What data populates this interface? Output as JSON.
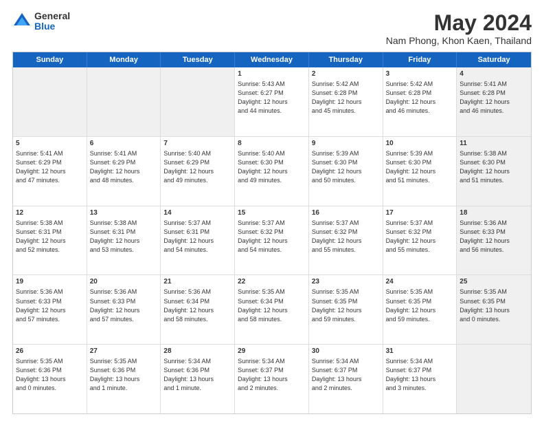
{
  "logo": {
    "general": "General",
    "blue": "Blue"
  },
  "title": "May 2024",
  "subtitle": "Nam Phong, Khon Kaen, Thailand",
  "header_days": [
    "Sunday",
    "Monday",
    "Tuesday",
    "Wednesday",
    "Thursday",
    "Friday",
    "Saturday"
  ],
  "weeks": [
    [
      {
        "day": "",
        "info": "",
        "shaded": true
      },
      {
        "day": "",
        "info": "",
        "shaded": true
      },
      {
        "day": "",
        "info": "",
        "shaded": true
      },
      {
        "day": "1",
        "info": "Sunrise: 5:43 AM\nSunset: 6:27 PM\nDaylight: 12 hours\nand 44 minutes.",
        "shaded": false
      },
      {
        "day": "2",
        "info": "Sunrise: 5:42 AM\nSunset: 6:28 PM\nDaylight: 12 hours\nand 45 minutes.",
        "shaded": false
      },
      {
        "day": "3",
        "info": "Sunrise: 5:42 AM\nSunset: 6:28 PM\nDaylight: 12 hours\nand 46 minutes.",
        "shaded": false
      },
      {
        "day": "4",
        "info": "Sunrise: 5:41 AM\nSunset: 6:28 PM\nDaylight: 12 hours\nand 46 minutes.",
        "shaded": true
      }
    ],
    [
      {
        "day": "5",
        "info": "Sunrise: 5:41 AM\nSunset: 6:29 PM\nDaylight: 12 hours\nand 47 minutes.",
        "shaded": false
      },
      {
        "day": "6",
        "info": "Sunrise: 5:41 AM\nSunset: 6:29 PM\nDaylight: 12 hours\nand 48 minutes.",
        "shaded": false
      },
      {
        "day": "7",
        "info": "Sunrise: 5:40 AM\nSunset: 6:29 PM\nDaylight: 12 hours\nand 49 minutes.",
        "shaded": false
      },
      {
        "day": "8",
        "info": "Sunrise: 5:40 AM\nSunset: 6:30 PM\nDaylight: 12 hours\nand 49 minutes.",
        "shaded": false
      },
      {
        "day": "9",
        "info": "Sunrise: 5:39 AM\nSunset: 6:30 PM\nDaylight: 12 hours\nand 50 minutes.",
        "shaded": false
      },
      {
        "day": "10",
        "info": "Sunrise: 5:39 AM\nSunset: 6:30 PM\nDaylight: 12 hours\nand 51 minutes.",
        "shaded": false
      },
      {
        "day": "11",
        "info": "Sunrise: 5:38 AM\nSunset: 6:30 PM\nDaylight: 12 hours\nand 51 minutes.",
        "shaded": true
      }
    ],
    [
      {
        "day": "12",
        "info": "Sunrise: 5:38 AM\nSunset: 6:31 PM\nDaylight: 12 hours\nand 52 minutes.",
        "shaded": false
      },
      {
        "day": "13",
        "info": "Sunrise: 5:38 AM\nSunset: 6:31 PM\nDaylight: 12 hours\nand 53 minutes.",
        "shaded": false
      },
      {
        "day": "14",
        "info": "Sunrise: 5:37 AM\nSunset: 6:31 PM\nDaylight: 12 hours\nand 54 minutes.",
        "shaded": false
      },
      {
        "day": "15",
        "info": "Sunrise: 5:37 AM\nSunset: 6:32 PM\nDaylight: 12 hours\nand 54 minutes.",
        "shaded": false
      },
      {
        "day": "16",
        "info": "Sunrise: 5:37 AM\nSunset: 6:32 PM\nDaylight: 12 hours\nand 55 minutes.",
        "shaded": false
      },
      {
        "day": "17",
        "info": "Sunrise: 5:37 AM\nSunset: 6:32 PM\nDaylight: 12 hours\nand 55 minutes.",
        "shaded": false
      },
      {
        "day": "18",
        "info": "Sunrise: 5:36 AM\nSunset: 6:33 PM\nDaylight: 12 hours\nand 56 minutes.",
        "shaded": true
      }
    ],
    [
      {
        "day": "19",
        "info": "Sunrise: 5:36 AM\nSunset: 6:33 PM\nDaylight: 12 hours\nand 57 minutes.",
        "shaded": false
      },
      {
        "day": "20",
        "info": "Sunrise: 5:36 AM\nSunset: 6:33 PM\nDaylight: 12 hours\nand 57 minutes.",
        "shaded": false
      },
      {
        "day": "21",
        "info": "Sunrise: 5:36 AM\nSunset: 6:34 PM\nDaylight: 12 hours\nand 58 minutes.",
        "shaded": false
      },
      {
        "day": "22",
        "info": "Sunrise: 5:35 AM\nSunset: 6:34 PM\nDaylight: 12 hours\nand 58 minutes.",
        "shaded": false
      },
      {
        "day": "23",
        "info": "Sunrise: 5:35 AM\nSunset: 6:35 PM\nDaylight: 12 hours\nand 59 minutes.",
        "shaded": false
      },
      {
        "day": "24",
        "info": "Sunrise: 5:35 AM\nSunset: 6:35 PM\nDaylight: 12 hours\nand 59 minutes.",
        "shaded": false
      },
      {
        "day": "25",
        "info": "Sunrise: 5:35 AM\nSunset: 6:35 PM\nDaylight: 13 hours\nand 0 minutes.",
        "shaded": true
      }
    ],
    [
      {
        "day": "26",
        "info": "Sunrise: 5:35 AM\nSunset: 6:36 PM\nDaylight: 13 hours\nand 0 minutes.",
        "shaded": false
      },
      {
        "day": "27",
        "info": "Sunrise: 5:35 AM\nSunset: 6:36 PM\nDaylight: 13 hours\nand 1 minute.",
        "shaded": false
      },
      {
        "day": "28",
        "info": "Sunrise: 5:34 AM\nSunset: 6:36 PM\nDaylight: 13 hours\nand 1 minute.",
        "shaded": false
      },
      {
        "day": "29",
        "info": "Sunrise: 5:34 AM\nSunset: 6:37 PM\nDaylight: 13 hours\nand 2 minutes.",
        "shaded": false
      },
      {
        "day": "30",
        "info": "Sunrise: 5:34 AM\nSunset: 6:37 PM\nDaylight: 13 hours\nand 2 minutes.",
        "shaded": false
      },
      {
        "day": "31",
        "info": "Sunrise: 5:34 AM\nSunset: 6:37 PM\nDaylight: 13 hours\nand 3 minutes.",
        "shaded": false
      },
      {
        "day": "",
        "info": "",
        "shaded": true
      }
    ]
  ]
}
